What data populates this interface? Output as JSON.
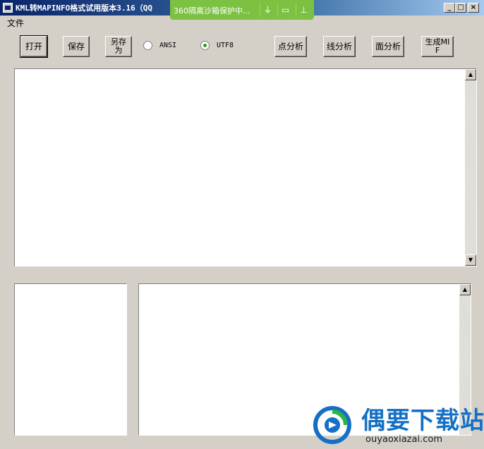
{
  "window": {
    "title": "KML转MAPINFO格式试用版本3.16（QQ",
    "controls": {
      "minimize": "_",
      "maximize": "□",
      "close": "×"
    }
  },
  "sandbox": {
    "text": "360隔离沙箱保护中...",
    "icons": [
      "plug-icon",
      "folder-icon",
      "pin-icon"
    ]
  },
  "menu": {
    "file": "文件"
  },
  "toolbar": {
    "open": "打开",
    "save": "保存",
    "save_as_line1": "另存",
    "save_as_line2": "为",
    "encoding_options": [
      {
        "label": "ANSI",
        "selected": false
      },
      {
        "label": "UTF8",
        "selected": true
      }
    ],
    "point_analysis": "点分析",
    "line_analysis": "线分析",
    "area_analysis": "面分析",
    "generate_mif_line1": "生成MI",
    "generate_mif_line2": "F"
  },
  "panes": {
    "top": "",
    "bottom_left": "",
    "bottom_right": ""
  },
  "watermark": {
    "title": "偶要下载站",
    "url": "ouyaoxiazai.com"
  },
  "colors": {
    "title_bar": "#0a246a",
    "sandbox_green": "#7cc142",
    "watermark_blue": "#1570c5",
    "face": "#d4d0c8"
  }
}
